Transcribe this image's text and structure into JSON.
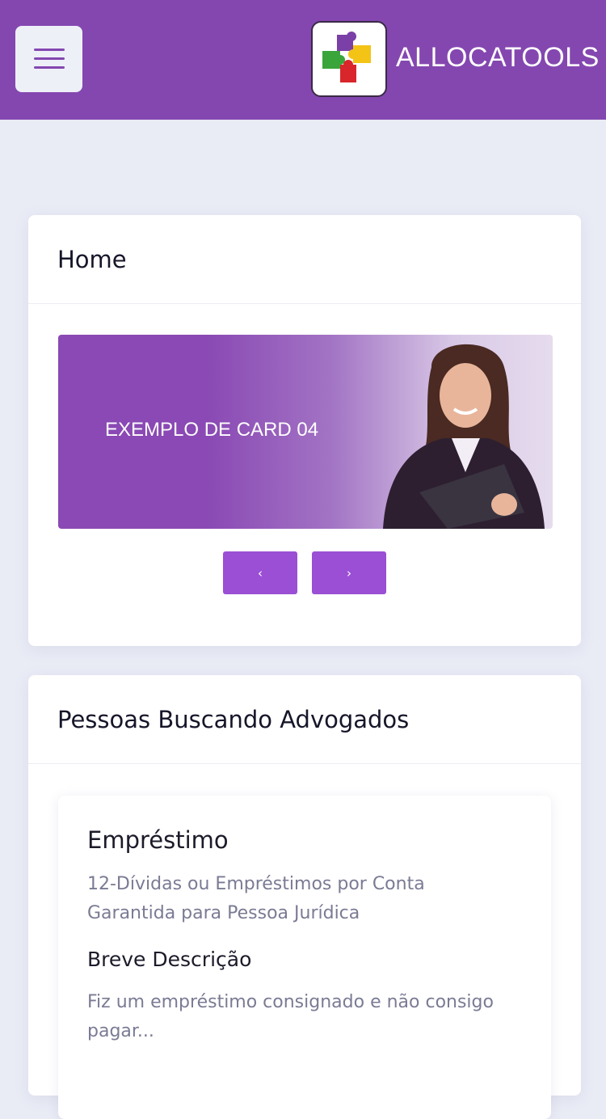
{
  "header": {
    "brand": "ALLOCATOOLS",
    "menu_icon": "hamburger-menu-icon",
    "logo_icon": "puzzle-logo-icon",
    "background": "#8447b0"
  },
  "home_card": {
    "title": "Home",
    "banner_text": "EXEMPLO DE CARD 04",
    "prev_label": "‹",
    "next_label": "›"
  },
  "seekers_card": {
    "title": "Pessoas Buscando Advogados",
    "item": {
      "title": "Empréstimo",
      "subtitle": "12-Dívidas ou Empréstimos por Conta Garantida para Pessoa Jurídica",
      "desc_heading": "Breve Descrição",
      "description": "Fiz um empréstimo consignado e não consigo pagar..."
    }
  },
  "colors": {
    "accent": "#9a4fd4",
    "page_bg": "#e9ebf5"
  }
}
